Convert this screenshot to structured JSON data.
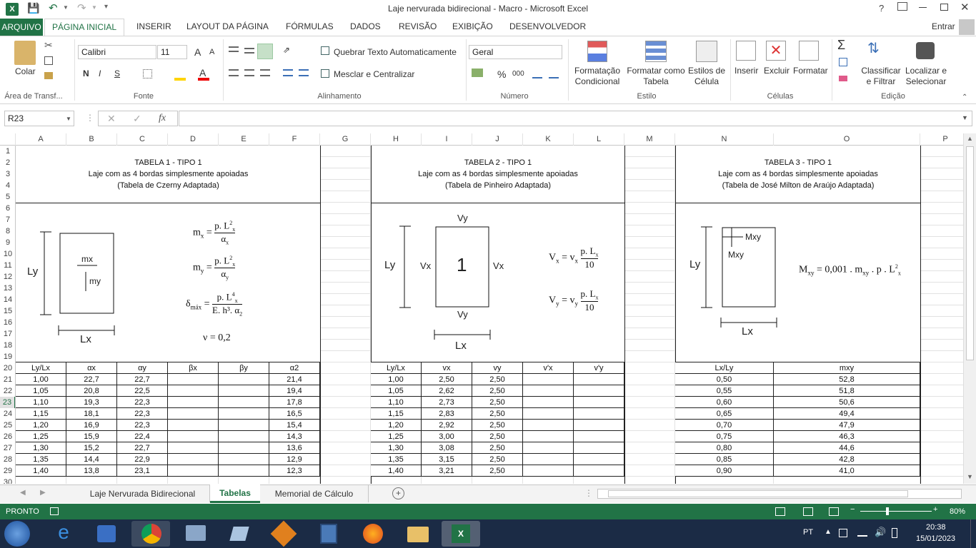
{
  "window": {
    "title": "Laje nervurada bidirecional - Macro - Microsoft Excel",
    "help": "?",
    "signin": "Entrar"
  },
  "tabs": [
    "ARQUIVO",
    "PÁGINA INICIAL",
    "INSERIR",
    "LAYOUT DA PÁGINA",
    "FÓRMULAS",
    "DADOS",
    "REVISÃO",
    "EXIBIÇÃO",
    "DESENVOLVEDOR"
  ],
  "ribbon": {
    "paste": "Colar",
    "clipboard": "Área de Transf...",
    "font_name": "Calibri",
    "font_size": "11",
    "font_group": "Fonte",
    "wrap": "Quebrar Texto Automaticamente",
    "merge": "Mesclar e Centralizar",
    "align_group": "Alinhamento",
    "number_format": "Geral",
    "number_group": "Número",
    "cond_fmt1": "Formatação",
    "cond_fmt2": "Condicional",
    "fmt_table1": "Formatar como",
    "fmt_table2": "Tabela",
    "cell_styles1": "Estilos de",
    "cell_styles2": "Célula",
    "styles_group": "Estilo",
    "insert": "Inserir",
    "delete": "Excluir",
    "format": "Formatar",
    "cells_group": "Células",
    "sort1": "Classificar",
    "sort2": "e Filtrar",
    "find1": "Localizar e",
    "find2": "Selecionar",
    "edit_group": "Edição",
    "bold": "N",
    "italic": "I",
    "underline": "S",
    "pct": "%",
    "thousands": "000",
    "fx": "fx"
  },
  "namebox": "R23",
  "columns": [
    "A",
    "B",
    "C",
    "D",
    "E",
    "F",
    "G",
    "H",
    "I",
    "J",
    "K",
    "L",
    "M",
    "N",
    "O",
    "P"
  ],
  "rows": [
    "1",
    "2",
    "3",
    "4",
    "5",
    "6",
    "7",
    "8",
    "9",
    "10",
    "11",
    "12",
    "13",
    "14",
    "15",
    "16",
    "17",
    "18",
    "19",
    "20",
    "21",
    "22",
    "23",
    "24",
    "25",
    "26",
    "27",
    "28",
    "29",
    "30"
  ],
  "table1": {
    "t1": "TABELA 1 - TIPO 1",
    "t2": "Laje com as 4 bordas simplesmente apoiadas",
    "t3": "(Tabela de Czerny Adaptada)",
    "headers": [
      "Ly/Lx",
      "αx",
      "αy",
      "βx",
      "βy",
      "α2"
    ],
    "rows": [
      [
        "1,00",
        "22,7",
        "22,7",
        "",
        "",
        "21,4"
      ],
      [
        "1,05",
        "20,8",
        "22,5",
        "",
        "",
        "19,4"
      ],
      [
        "1,10",
        "19,3",
        "22,3",
        "",
        "",
        "17,8"
      ],
      [
        "1,15",
        "18,1",
        "22,3",
        "",
        "",
        "16,5"
      ],
      [
        "1,20",
        "16,9",
        "22,3",
        "",
        "",
        "15,4"
      ],
      [
        "1,25",
        "15,9",
        "22,4",
        "",
        "",
        "14,3"
      ],
      [
        "1,30",
        "15,2",
        "22,7",
        "",
        "",
        "13,6"
      ],
      [
        "1,35",
        "14,4",
        "22,9",
        "",
        "",
        "12,9"
      ],
      [
        "1,40",
        "13,8",
        "23,1",
        "",
        "",
        "12,3"
      ]
    ],
    "ly": "Ly",
    "lx": "Lx",
    "mx": "mx",
    "my": "my"
  },
  "table2": {
    "t1": "TABELA 2 - TIPO 1",
    "t2": "Laje com as 4 bordas simplesmente apoiadas",
    "t3": "(Tabela de Pinheiro Adaptada)",
    "headers": [
      "Ly/Lx",
      "vx",
      "vy",
      "v'x",
      "v'y"
    ],
    "rows": [
      [
        "1,00",
        "2,50",
        "2,50",
        "",
        ""
      ],
      [
        "1,05",
        "2,62",
        "2,50",
        "",
        ""
      ],
      [
        "1,10",
        "2,73",
        "2,50",
        "",
        ""
      ],
      [
        "1,15",
        "2,83",
        "2,50",
        "",
        ""
      ],
      [
        "1,20",
        "2,92",
        "2,50",
        "",
        ""
      ],
      [
        "1,25",
        "3,00",
        "2,50",
        "",
        ""
      ],
      [
        "1,30",
        "3,08",
        "2,50",
        "",
        ""
      ],
      [
        "1,35",
        "3,15",
        "2,50",
        "",
        ""
      ],
      [
        "1,40",
        "3,21",
        "2,50",
        "",
        ""
      ]
    ],
    "vy": "Vy",
    "vx": "Vx",
    "num": "1",
    "ly": "Ly",
    "lx": "Lx"
  },
  "table3": {
    "t1": "TABELA 3 - TIPO 1",
    "t2": "Laje com as 4 bordas simplesmente apoiadas",
    "t3": "(Tabela de José Milton de Araújo Adaptada)",
    "headers": [
      "Lx/Ly",
      "mxy"
    ],
    "rows": [
      [
        "0,50",
        "52,8"
      ],
      [
        "0,55",
        "51,8"
      ],
      [
        "0,60",
        "50,6"
      ],
      [
        "0,65",
        "49,4"
      ],
      [
        "0,70",
        "47,9"
      ],
      [
        "0,75",
        "46,3"
      ],
      [
        "0,80",
        "44,6"
      ],
      [
        "0,85",
        "42,8"
      ],
      [
        "0,90",
        "41,0"
      ]
    ],
    "ly": "Ly",
    "lx": "Lx",
    "mxy": "Mxy"
  },
  "sheets": [
    "Laje Nervurada Bidirecional",
    "Tabelas",
    "Memorial de Cálculo"
  ],
  "status": {
    "ready": "PRONTO",
    "zoom": "80%"
  },
  "taskbar": {
    "lang": "PT",
    "time": "20:38",
    "date": "15/01/2023"
  }
}
